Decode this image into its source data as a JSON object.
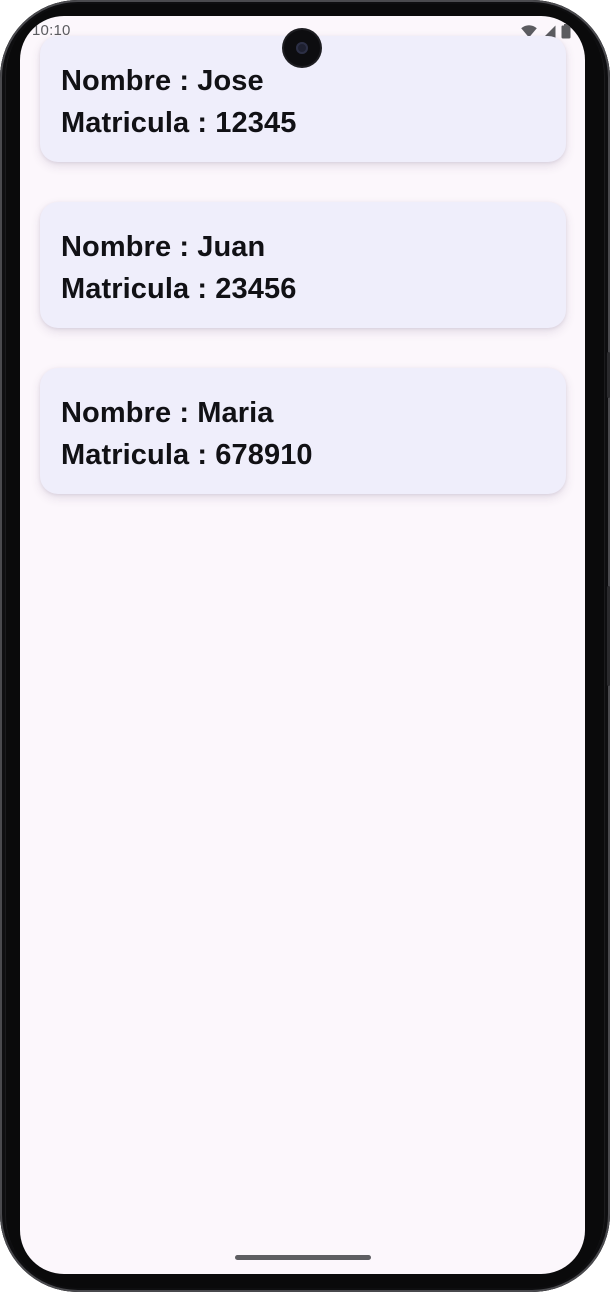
{
  "status_bar": {
    "time": "10:10",
    "icons": [
      "wifi-icon",
      "cell-signal-icon",
      "battery-icon"
    ]
  },
  "students": [
    {
      "name_line": "Nombre : Jose",
      "id_line": "Matricula : 12345"
    },
    {
      "name_line": "Nombre : Juan",
      "id_line": "Matricula : 23456"
    },
    {
      "name_line": "Nombre : Maria",
      "id_line": "Matricula : 678910"
    }
  ],
  "colors": {
    "screen_background": "#fcf7fc",
    "card_background": "#efeefb",
    "text": "#111115"
  }
}
